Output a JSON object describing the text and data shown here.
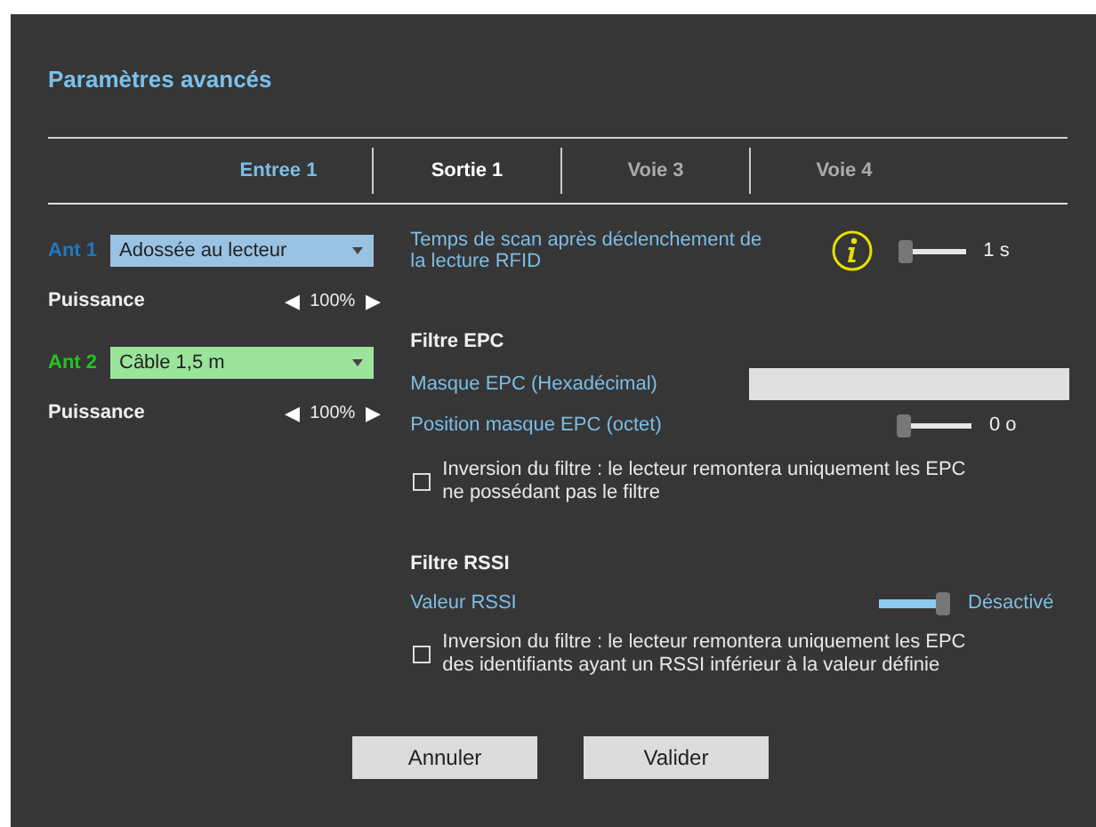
{
  "dialog": {
    "title": "Paramètres avancés"
  },
  "tabs": [
    {
      "label": "Entree 1",
      "selected": true,
      "disabled": false
    },
    {
      "label": "Sortie 1",
      "selected": false,
      "disabled": false
    },
    {
      "label": "Voie 3",
      "selected": false,
      "disabled": true
    },
    {
      "label": "Voie 4",
      "selected": false,
      "disabled": true
    }
  ],
  "antennas": [
    {
      "label": "Ant 1",
      "color": "#1f78c1",
      "value": "Adossée au lecteur",
      "power_label": "Puissance",
      "power": "100%",
      "left_arrow": "◀",
      "right_arrow": "▶"
    },
    {
      "label": "Ant 2",
      "color": "#22c322",
      "value": "Câble 1,5 m",
      "power_label": "Puissance",
      "power": "100%",
      "left_arrow": "◀",
      "right_arrow": "▶"
    }
  ],
  "scan_time": {
    "label": "Temps de scan après déclenchement de la lecture RFID",
    "level": 0,
    "reading": "1 s"
  },
  "epc_filter": {
    "heading": "Filtre EPC",
    "mask_label": "Masque EPC (Hexadécimal)",
    "position_label": "Position masque EPC (octet)",
    "position_slider": {
      "level": 0,
      "reading": "0 o"
    },
    "invert_checked": false,
    "invert_label": "Inversion du filtre : le lecteur remontera uniquement les EPC ne possédant pas le filtre"
  },
  "rssi_filter": {
    "heading": "Filtre RSSI",
    "value_label": "Valeur RSSI",
    "level": 1,
    "reading": "Désactivé",
    "invert_checked": false,
    "invert_label": "Inversion du filtre : le lecteur remontera uniquement les EPC des identifiants ayant un RSSI inférieur à la valeur définie"
  },
  "buttons": [
    "Annuler",
    "Valider"
  ]
}
